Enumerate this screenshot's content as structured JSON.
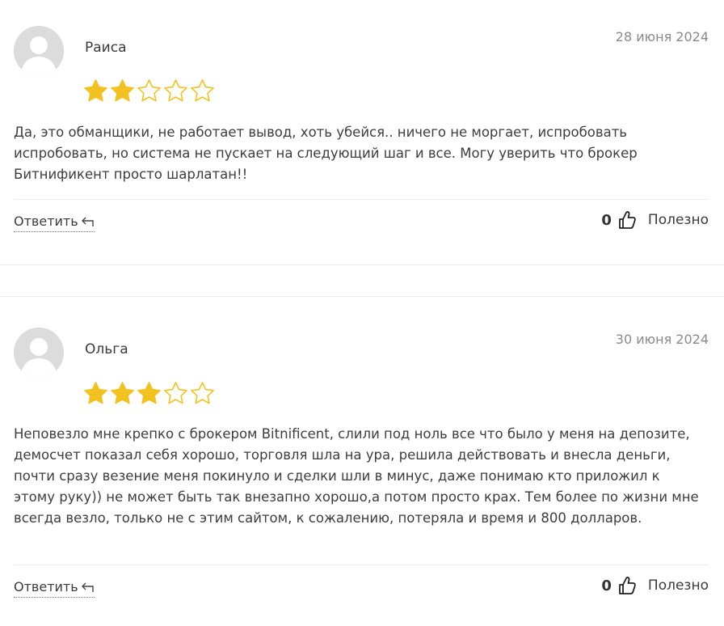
{
  "colors": {
    "star_filled": "#f2c320",
    "star_empty": "#f2c320",
    "divider": "#ececec"
  },
  "icons": {
    "avatar": "user-placeholder-icon",
    "reply": "reply-arrow-icon",
    "thumb": "thumbs-up-icon",
    "star": "star-icon"
  },
  "reviews": [
    {
      "author": "Раиса",
      "date": "28 июня 2024",
      "rating": 2,
      "max_rating": 5,
      "text": "Да, это обманщики, не работает вывод, хоть убейся.. ничего не моргает, испробовать испробовать, но система не пускает на следующий шаг и все. Могу уверить что брокер Битнификент просто шарлатан!!",
      "reply_label": "Ответить",
      "helpful_count": "0",
      "helpful_label": "Полезно"
    },
    {
      "author": "Ольга",
      "date": "30 июня 2024",
      "rating": 3,
      "max_rating": 5,
      "text": "Неповезло мне крепко с брокером Bitnificent, слили под ноль все что было у меня на депозите, демосчет показал себя хорошо, торговля шла на ура, решила действовать и внесла деньги, почти сразу везение меня покинуло и сделки шли в минус, даже понимаю кто приложил к этому руку)) не может быть так внезапно хорошо,а потом просто крах. Тем более по жизни мне всегда везло, только не с этим сайтом, к сожалению, потеряла и время и 800 долларов.",
      "reply_label": "Ответить",
      "helpful_count": "0",
      "helpful_label": "Полезно"
    }
  ]
}
